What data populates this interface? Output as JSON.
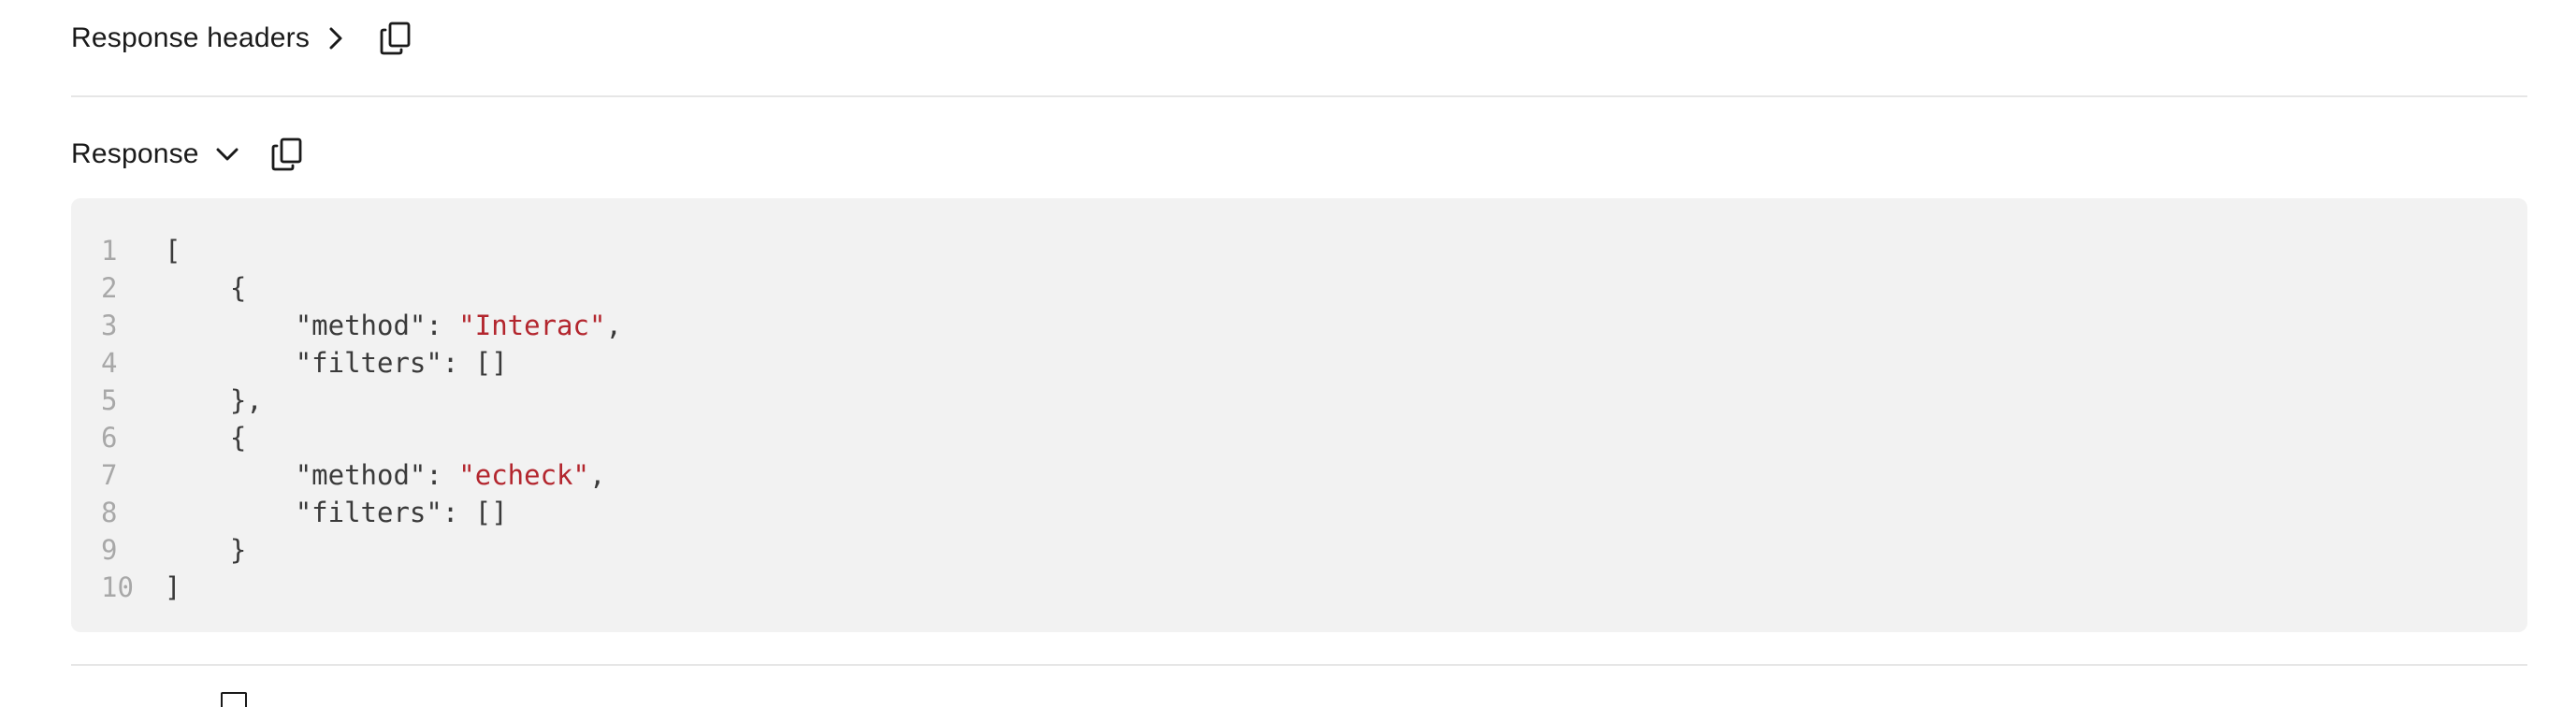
{
  "response_headers": {
    "title": "Response headers",
    "expand_icon": "chevron-right-icon",
    "copy_icon": "copy-icon"
  },
  "response": {
    "title": "Response",
    "expand_icon": "chevron-down-icon",
    "copy_icon": "copy-icon",
    "code_lines": [
      {
        "num": "1",
        "indent": "",
        "pre": "[",
        "str": "",
        "post": ""
      },
      {
        "num": "2",
        "indent": "    ",
        "pre": "{",
        "str": "",
        "post": ""
      },
      {
        "num": "3",
        "indent": "        ",
        "pre": "\"method\": ",
        "str": "\"Interac\"",
        "post": ","
      },
      {
        "num": "4",
        "indent": "        ",
        "pre": "\"filters\": []",
        "str": "",
        "post": ""
      },
      {
        "num": "5",
        "indent": "    ",
        "pre": "},",
        "str": "",
        "post": ""
      },
      {
        "num": "6",
        "indent": "    ",
        "pre": "{",
        "str": "",
        "post": ""
      },
      {
        "num": "7",
        "indent": "        ",
        "pre": "\"method\": ",
        "str": "\"echeck\"",
        "post": ","
      },
      {
        "num": "8",
        "indent": "        ",
        "pre": "\"filters\": []",
        "str": "",
        "post": ""
      },
      {
        "num": "9",
        "indent": "    ",
        "pre": "}",
        "str": "",
        "post": ""
      },
      {
        "num": "10",
        "indent": "",
        "pre": "]",
        "str": "",
        "post": ""
      }
    ]
  },
  "colors": {
    "string": "#b3262e",
    "code_bg": "#f2f2f2",
    "line_number": "#a8a8a8",
    "divider": "#e6e6e6"
  }
}
